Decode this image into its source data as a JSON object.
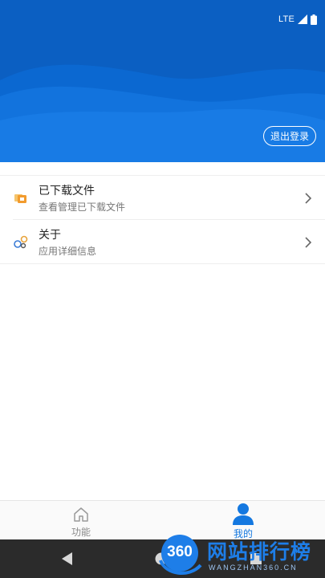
{
  "status_bar": {
    "network": "LTE",
    "signal_icon": "signal-icon",
    "battery_icon": "battery-icon"
  },
  "colors": {
    "header": "#0a63c9",
    "accent": "#1478e0",
    "text": "#222222",
    "subtext": "#777777",
    "nav": "#2b2b2b"
  },
  "header": {
    "logout_label": "退出登录"
  },
  "list": {
    "items": [
      {
        "title": "已下载文件",
        "subtitle": "查看管理已下载文件",
        "icon": "folder-icon"
      },
      {
        "title": "关于",
        "subtitle": "应用详细信息",
        "icon": "about-icon"
      }
    ]
  },
  "tabs": [
    {
      "label": "功能",
      "icon": "home-icon",
      "active": false
    },
    {
      "label": "我的",
      "icon": "profile-icon",
      "active": true
    }
  ],
  "watermark": {
    "number": "360",
    "text": "网站排行榜",
    "url": "WANGZHAN360.CN"
  },
  "nav": {
    "back_icon": "back-icon",
    "home_icon": "home-circle-icon",
    "recents_icon": "recents-icon"
  }
}
